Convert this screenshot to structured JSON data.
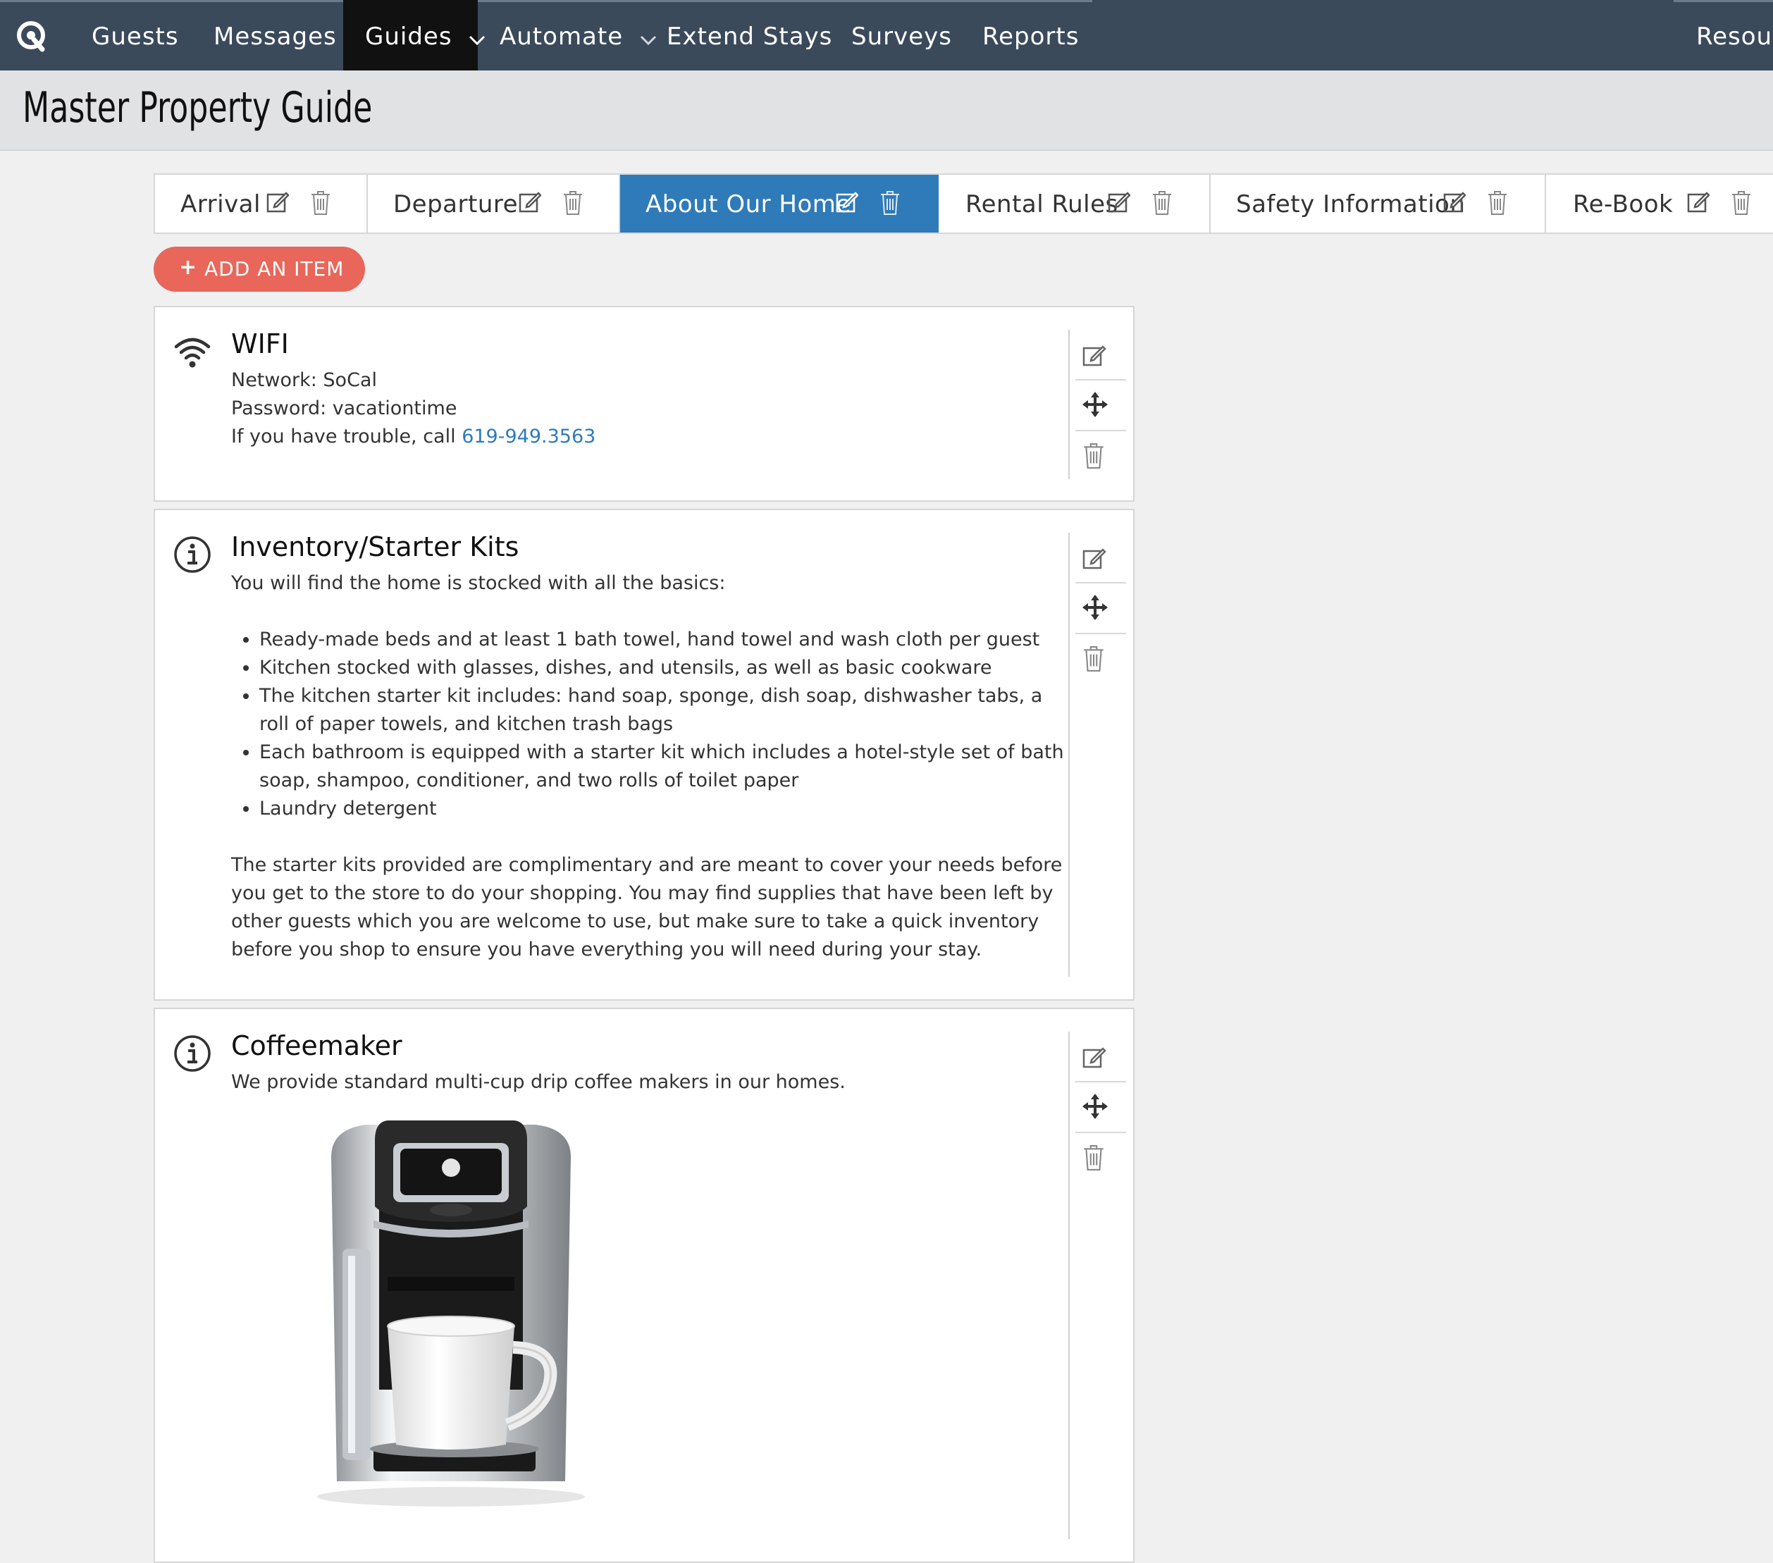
{
  "nav": {
    "items": [
      {
        "label": "Guests"
      },
      {
        "label": "Messages"
      },
      {
        "label": "Guides"
      },
      {
        "label": "Automate"
      },
      {
        "label": "Extend Stays"
      },
      {
        "label": "Surveys"
      },
      {
        "label": "Reports"
      },
      {
        "label": "Resour"
      }
    ],
    "active": "Guides"
  },
  "page": {
    "title": "Master Property Guide"
  },
  "tabs": [
    {
      "label": "Arrival"
    },
    {
      "label": "Departure"
    },
    {
      "label": "About Our Home"
    },
    {
      "label": "Rental Rules"
    },
    {
      "label": "Safety Information"
    },
    {
      "label": "Re-Book"
    }
  ],
  "active_tab": "About Our Home",
  "add_button": {
    "label": "ADD AN ITEM"
  },
  "items": [
    {
      "icon": "wifi-icon",
      "title": "WIFI",
      "lines": [
        "Network: SoCal",
        "Password: vacationtime"
      ],
      "trouble_prefix": "If you have trouble, call ",
      "trouble_phone": "619-949.3563"
    },
    {
      "icon": "info-icon",
      "title": "Inventory/Starter Kits",
      "intro": "You will find the home is stocked with all the basics:",
      "bullets": [
        "Ready-made beds and at least 1 bath towel, hand towel and wash cloth per guest",
        "Kitchen stocked with glasses, dishes, and utensils, as well as basic cookware",
        "The kitchen starter kit includes: hand soap, sponge, dish soap, dishwasher tabs, a roll of paper towels, and kitchen trash bags",
        "Each bathroom is equipped with a starter kit which includes a hotel-style set of bath soap, shampoo, conditioner, and two rolls of toilet paper",
        "Laundry detergent"
      ],
      "outro": "The starter kits provided are complimentary and are meant to cover your needs before you get to the store to do your shopping. You may find supplies that have been left by other guests which you are welcome to use, but make sure to take a quick inventory before you shop to ensure you have everything you will need during your stay."
    },
    {
      "icon": "info-icon",
      "title": "Coffeemaker",
      "text": "We provide standard multi-cup drip coffee makers in our homes.",
      "image": "coffee-maker-image"
    }
  ],
  "colors": {
    "nav_bg": "#3b4a5b",
    "active_nav": "#111111",
    "active_tab": "#2f7ab8",
    "add_button": "#e8675a",
    "link": "#2f7ab8"
  }
}
